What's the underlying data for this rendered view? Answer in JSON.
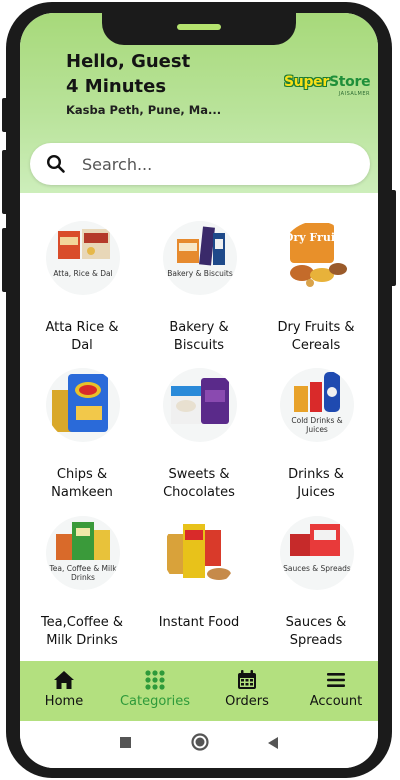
{
  "header": {
    "greeting": "Hello, Guest",
    "eta": "4 Minutes",
    "address": "Kasba Peth, Pune, Ma..."
  },
  "logo": {
    "super": "Super",
    "store": "Store",
    "sub": "JAISALMER"
  },
  "search": {
    "placeholder": "Search..."
  },
  "categories": [
    {
      "label_line1": "Atta Rice &",
      "label_line2": "Dal",
      "caption": "Atta, Rice & Dal",
      "icon": "atta-rice-dal-icon"
    },
    {
      "label_line1": "Bakery &",
      "label_line2": "Biscuits",
      "caption": "Bakery & Biscuits",
      "icon": "bakery-biscuits-icon"
    },
    {
      "label_line1": "Dry Fruits &",
      "label_line2": "Cereals",
      "caption": "Dry Fruit",
      "icon": "dry-fruits-icon"
    },
    {
      "label_line1": "Chips &",
      "label_line2": "Namkeen",
      "caption": "",
      "icon": "chips-namkeen-icon"
    },
    {
      "label_line1": "Sweets &",
      "label_line2": "Chocolates",
      "caption": "",
      "icon": "sweets-chocolates-icon"
    },
    {
      "label_line1": "Drinks &",
      "label_line2": "Juices",
      "caption": "Cold Drinks & Juices",
      "icon": "drinks-juices-icon"
    },
    {
      "label_line1": "Tea,Coffee &",
      "label_line2": "Milk Drinks",
      "caption": "Tea, Coffee & Milk Drinks",
      "icon": "tea-coffee-icon"
    },
    {
      "label_line1": "Instant Food",
      "label_line2": "",
      "caption": "",
      "icon": "instant-food-icon"
    },
    {
      "label_line1": "Sauces &",
      "label_line2": "Spreads",
      "caption": "Sauces & Spreads",
      "icon": "sauces-spreads-icon"
    }
  ],
  "nav": {
    "home": "Home",
    "categories": "Categories",
    "orders": "Orders",
    "account": "Account"
  },
  "colors": {
    "header_green": "#a7d97a",
    "nav_green": "#b3e07f",
    "active_green": "#2e9a3a"
  }
}
